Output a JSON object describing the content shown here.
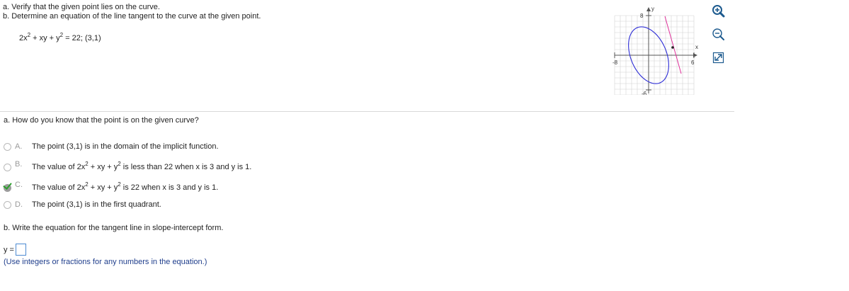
{
  "question": {
    "line_a": "a. Verify that the given point lies on the curve.",
    "line_b": "b. Determine an equation of the line tangent to the curve at the given point.",
    "equation": {
      "t1": "2x",
      "s1": "2",
      "t2": " + xy + y",
      "s2": "2",
      "t3": " = 22; (3,1)"
    }
  },
  "graph": {
    "x_label": "x",
    "y_label": "y",
    "x_min_label": "-8",
    "x_max_label": "6",
    "y_max_label": "8",
    "y_min_label": "-6",
    "colors": {
      "curve": "#2b2bd6",
      "tangent": "#e0309a",
      "point": "#222222",
      "grid": "#d4d4d4"
    }
  },
  "tools": {
    "zoom_in": "zoom-in-icon",
    "zoom_out": "zoom-out-icon",
    "expand": "expand-icon"
  },
  "part_a": {
    "prompt": "a. How do you know that the point is on the given curve?",
    "selected": "C",
    "options": [
      {
        "letter": "A.",
        "text": "The point (3,1) is in the domain of the implicit function."
      },
      {
        "letter": "B.",
        "t1": "The value of 2x",
        "s1": "2",
        "t2": " + xy + y",
        "s2": "2",
        "t3": " is less than 22 when x is 3 and y is 1."
      },
      {
        "letter": "C.",
        "t1": "The value of 2x",
        "s1": "2",
        "t2": " + xy + y",
        "s2": "2",
        "t3": " is 22 when x is 3 and y is 1."
      },
      {
        "letter": "D.",
        "text": "The point (3,1) is in the first quadrant."
      }
    ]
  },
  "part_b": {
    "prompt": "b. Write the equation for the tangent line in slope-intercept form.",
    "answer_label": "y =",
    "hint": "(Use integers or fractions for any numbers in the equation.)"
  }
}
